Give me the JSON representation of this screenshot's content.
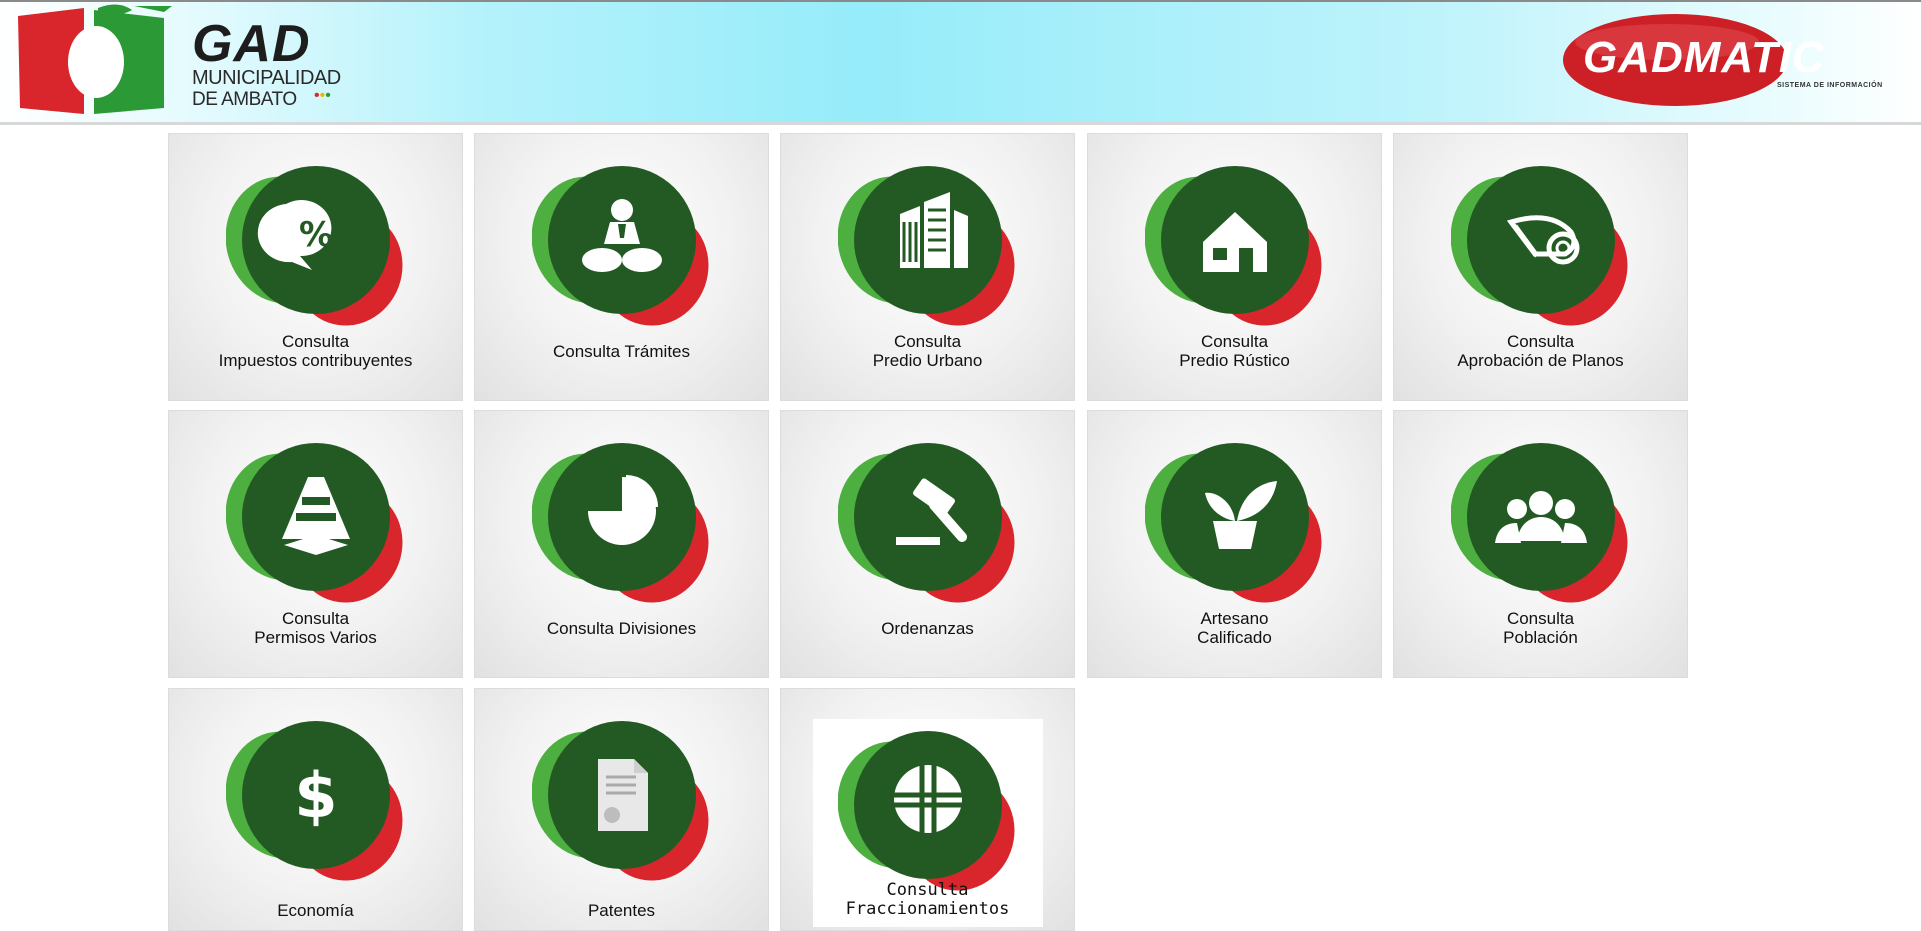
{
  "header": {
    "logo_left": {
      "title": "GAD",
      "line1": "MUNICIPALIDAD",
      "line2": "DE AMBATO"
    },
    "logo_right": {
      "brand": "GADMATIC",
      "tagline": "SISTEMA DE INFORMACIÓN"
    }
  },
  "tiles": [
    {
      "id": "impuestos",
      "label1": "Consulta",
      "label2": "Impuestos contribuyentes",
      "icon": "percent-chat-icon"
    },
    {
      "id": "tramites",
      "label1": "Consulta Trámites",
      "label2": "",
      "icon": "person-icon"
    },
    {
      "id": "predio-urbano",
      "label1": "Consulta",
      "label2": "Predio Urbano",
      "icon": "building-icon"
    },
    {
      "id": "predio-rustico",
      "label1": "Consulta",
      "label2": "Predio Rústico",
      "icon": "house-icon"
    },
    {
      "id": "planos",
      "label1": "Consulta",
      "label2": "Aprobación de Planos",
      "icon": "plan-roll-icon"
    },
    {
      "id": "permisos",
      "label1": "Consulta",
      "label2": "Permisos Varios",
      "icon": "traffic-cone-icon"
    },
    {
      "id": "divisiones",
      "label1": "Consulta Divisiones",
      "label2": "",
      "icon": "pie-chart-icon"
    },
    {
      "id": "ordenanzas",
      "label1": "Ordenanzas",
      "label2": "",
      "icon": "gavel-icon"
    },
    {
      "id": "artesano",
      "label1": "Artesano",
      "label2": "Calificado",
      "icon": "plant-pot-icon"
    },
    {
      "id": "poblacion",
      "label1": "Consulta",
      "label2": "Población",
      "icon": "people-group-icon"
    },
    {
      "id": "economia",
      "label1": "Economía",
      "label2": "",
      "icon": "dollar-icon"
    },
    {
      "id": "patentes",
      "label1": "Patentes",
      "label2": "",
      "icon": "certificate-icon"
    },
    {
      "id": "fraccionamientos",
      "label1": "Consulta",
      "label2": "Fraccionamientos",
      "icon": "land-parcel-icon"
    }
  ],
  "colors": {
    "circle_green": "#235a23",
    "blob_light_green": "#4caf3f",
    "blob_red": "#d8262c",
    "brand_red": "#cc2026",
    "brand_green": "#1f8a2a"
  }
}
